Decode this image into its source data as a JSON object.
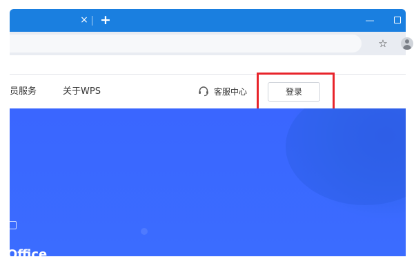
{
  "browser": {
    "tab_close_glyph": "×",
    "new_tab_glyph": "+",
    "minimize_glyph": "—",
    "bookmark_glyph": "☆"
  },
  "nav": {
    "member_services": "员服务",
    "about": "关于WPS",
    "support": "客服中心",
    "login": "登录"
  },
  "hero": {
    "text": "Office",
    "mark_glyph": "⊡",
    "background_color": "#3b6cff"
  },
  "annotation": {
    "highlight_color": "#e8242b"
  }
}
